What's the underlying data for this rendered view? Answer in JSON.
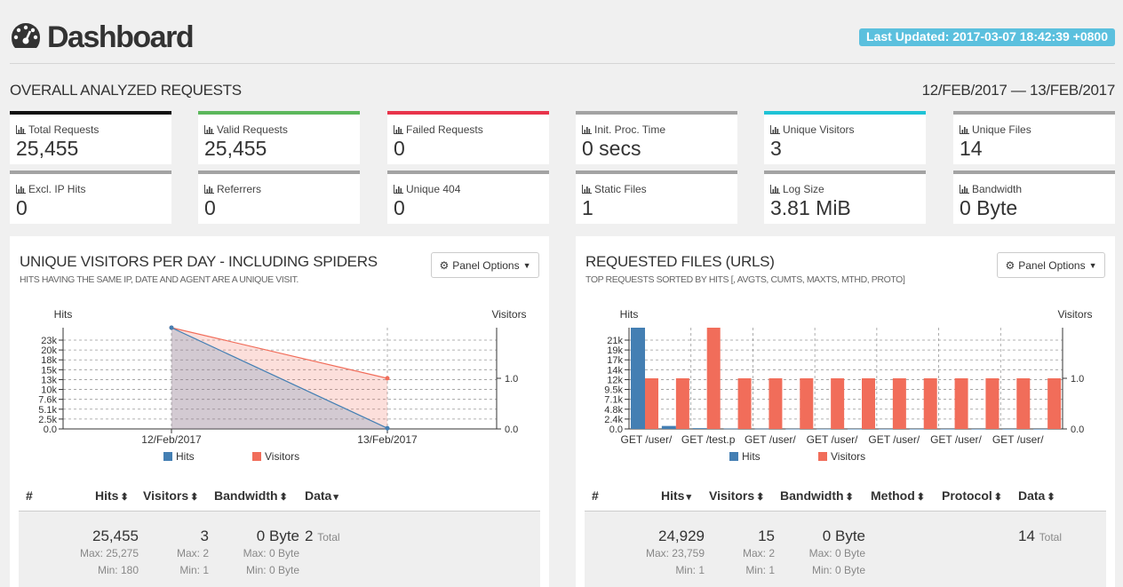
{
  "header": {
    "title": "Dashboard",
    "last_updated": "Last Updated: 2017-03-07 18:42:39 +0800"
  },
  "overall": {
    "title": "OVERALL ANALYZED REQUESTS",
    "date_range": "12/FEB/2017 — 13/FEB/2017",
    "cards": [
      {
        "label": "Total Requests",
        "value": "25,455",
        "color": "#111111"
      },
      {
        "label": "Valid Requests",
        "value": "25,455",
        "color": "#5cb85c"
      },
      {
        "label": "Failed Requests",
        "value": "0",
        "color": "#e8344b"
      },
      {
        "label": "Init. Proc. Time",
        "value": "0 secs",
        "color": "#a3a3a3"
      },
      {
        "label": "Unique Visitors",
        "value": "3",
        "color": "#1fc3d6"
      },
      {
        "label": "Unique Files",
        "value": "14",
        "color": "#a3a3a3"
      },
      {
        "label": "Excl. IP Hits",
        "value": "0",
        "color": "#a3a3a3"
      },
      {
        "label": "Referrers",
        "value": "0",
        "color": "#a3a3a3"
      },
      {
        "label": "Unique 404",
        "value": "0",
        "color": "#a3a3a3"
      },
      {
        "label": "Static Files",
        "value": "1",
        "color": "#a3a3a3"
      },
      {
        "label": "Log Size",
        "value": "3.81 MiB",
        "color": "#a3a3a3"
      },
      {
        "label": "Bandwidth",
        "value": "0 Byte",
        "color": "#a3a3a3"
      }
    ]
  },
  "visitors_panel": {
    "title": "UNIQUE VISITORS PER DAY - INCLUDING SPIDERS",
    "subtitle": "HITS HAVING THE SAME IP, DATE AND AGENT ARE A UNIQUE VISIT.",
    "options_label": "Panel Options",
    "table": {
      "headers": [
        "#",
        "Hits",
        "Visitors",
        "Bandwidth",
        "Data"
      ],
      "hits": "25,455",
      "hits_max": "Max: 25,275",
      "hits_min": "Min: 180",
      "visitors": "3",
      "visitors_max": "Max: 2",
      "visitors_min": "Min: 1",
      "bandwidth": "0 Byte",
      "bw_max": "Max: 0 Byte",
      "bw_min": "Min: 0 Byte",
      "data": "2",
      "data_label": "Total"
    }
  },
  "requests_panel": {
    "title": "REQUESTED FILES (URLS)",
    "subtitle": "TOP REQUESTS SORTED BY HITS [, AVGTS, CUMTS, MAXTS, MTHD, PROTO]",
    "options_label": "Panel Options",
    "table": {
      "headers": [
        "#",
        "Hits",
        "Visitors",
        "Bandwidth",
        "Method",
        "Protocol",
        "Data"
      ],
      "hits": "24,929",
      "hits_max": "Max: 23,759",
      "hits_min": "Min: 1",
      "visitors": "15",
      "visitors_max": "Max: 2",
      "visitors_min": "Min: 1",
      "bandwidth": "0 Byte",
      "bw_max": "Max: 0 Byte",
      "bw_min": "Min: 0 Byte",
      "data": "14",
      "data_label": "Total"
    }
  },
  "chart_data": [
    {
      "type": "area",
      "x": [
        "12/Feb/2017",
        "13/Feb/2017"
      ],
      "ylabel": "Hits",
      "y2label": "Visitors",
      "y_ticks": [
        "0.0",
        "2.5k",
        "5.1k",
        "7.6k",
        "10k",
        "13k",
        "15k",
        "18k",
        "20k",
        "23k"
      ],
      "y2_ticks": [
        "0.0",
        "1.0"
      ],
      "ylim": [
        0,
        25275
      ],
      "y2lim": [
        0,
        2
      ],
      "series": [
        {
          "name": "Hits",
          "values": [
            25275,
            180
          ],
          "color": "#447fb3"
        },
        {
          "name": "Visitors",
          "values": [
            2,
            1
          ],
          "color": "#f16d5a"
        }
      ]
    },
    {
      "type": "bar",
      "categories": [
        "GET /user/",
        "",
        "GET /test.p",
        "",
        "GET /user/",
        "",
        "GET /user/",
        "",
        "GET /user/",
        "",
        "GET /user/",
        "",
        "GET /user/",
        ""
      ],
      "ylabel": "Hits",
      "y2label": "Visitors",
      "y_ticks": [
        "0.0",
        "2.4k",
        "4.8k",
        "7.1k",
        "9.5k",
        "12k",
        "14k",
        "17k",
        "19k",
        "21k"
      ],
      "y2_ticks": [
        "0.0",
        "1.0"
      ],
      "ylim": [
        0,
        23759
      ],
      "y2lim": [
        0,
        2
      ],
      "series": [
        {
          "name": "Hits",
          "values": [
            23759,
            700,
            180,
            80,
            60,
            30,
            20,
            15,
            10,
            8,
            6,
            5,
            3,
            1
          ],
          "color": "#447fb3"
        },
        {
          "name": "Visitors",
          "values": [
            1,
            1,
            2,
            1,
            1,
            1,
            1,
            1,
            1,
            1,
            1,
            1,
            1,
            1
          ],
          "color": "#f16d5a"
        }
      ]
    }
  ]
}
